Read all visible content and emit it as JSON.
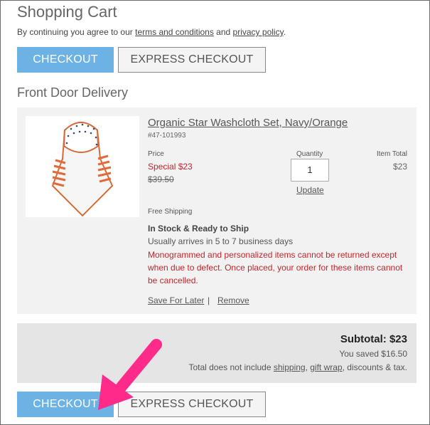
{
  "page": {
    "title": "Shopping Cart",
    "terms": {
      "prefix": "By continuing you agree to our ",
      "terms_link": "terms and conditions",
      "and": " and ",
      "privacy_link": "privacy policy",
      "suffix": "."
    }
  },
  "buttons": {
    "checkout": "CHECKOUT",
    "express_checkout": "EXPRESS CHECKOUT"
  },
  "section": {
    "heading": "Front Door Delivery"
  },
  "item": {
    "name": "Organic Star Washcloth Set, Navy/Orange",
    "sku": "#47-101993",
    "price_label": "Price",
    "special_price": "Special $23",
    "original_price": "$39.50",
    "quantity_label": "Quantity",
    "quantity_value": "1",
    "update_link": "Update",
    "item_total_label": "Item Total",
    "item_total": "$23",
    "free_shipping": "Free Shipping",
    "stock_status": "In Stock & Ready to Ship",
    "arrival": "Usually arrives in 5 to 7 business days",
    "warning": "Monogrammed and personalized items cannot be returned except when due to defect. Once placed, your order for these items cannot be cancelled.",
    "save_for_later": "Save For Later",
    "separator": "|",
    "remove": "Remove",
    "image_icon": "hooded-towel-image"
  },
  "summary": {
    "subtotal": "Subtotal: $23",
    "saved": "You saved $16.50",
    "disclaimer_prefix": "Total does not include ",
    "shipping_link": "shipping",
    "comma": ", ",
    "gift_wrap_link": "gift wrap",
    "disclaimer_suffix": ", discounts & tax."
  },
  "annotation": {
    "icon": "pink-arrow-icon",
    "color": "#ff2a8a"
  },
  "colors": {
    "checkout_bg": "#6cb2e4",
    "warning_red": "#c0262c",
    "card_bg": "#f2f2f2",
    "summary_bg": "#e5e5e5"
  }
}
